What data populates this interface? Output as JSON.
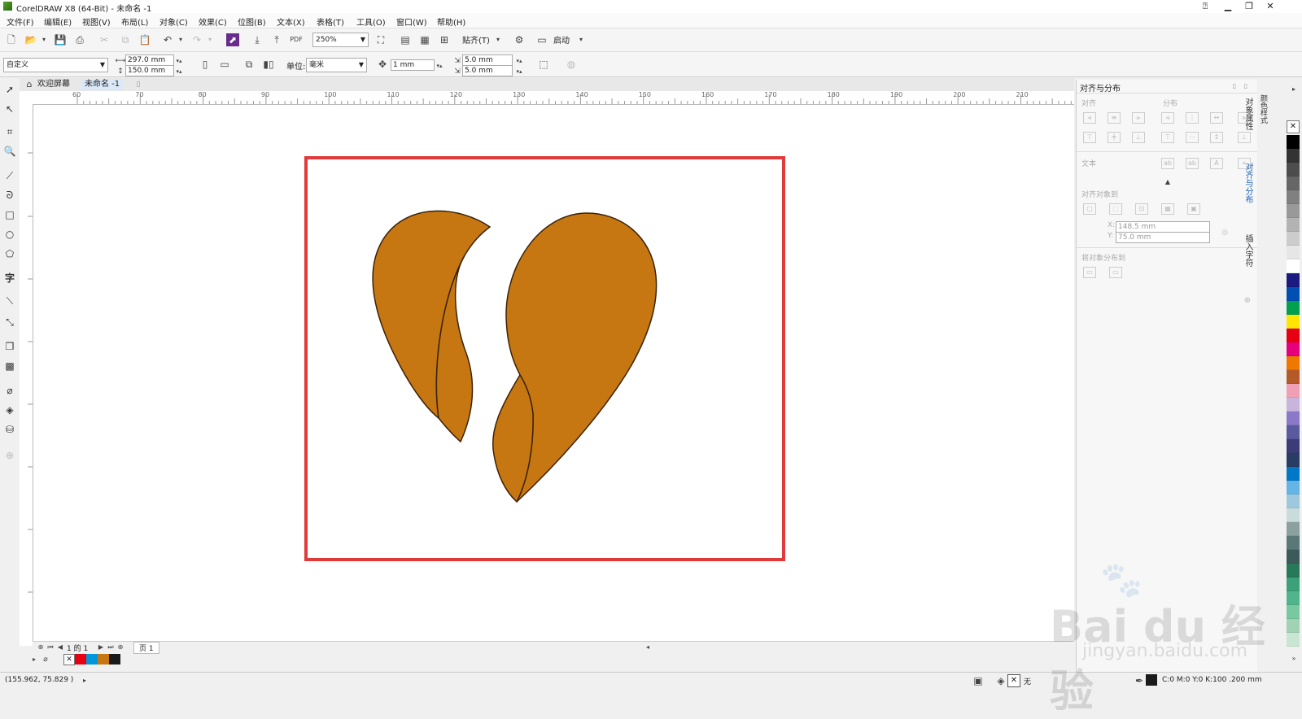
{
  "window": {
    "title": "CorelDRAW X8 (64-Bit) - 未命名 -1"
  },
  "menu": [
    "文件(F)",
    "编辑(E)",
    "视图(V)",
    "布局(L)",
    "对象(C)",
    "效果(C)",
    "位图(B)",
    "文本(X)",
    "表格(T)",
    "工具(O)",
    "窗口(W)",
    "帮助(H)"
  ],
  "toolbar": {
    "zoom": "250%",
    "snap_label": "贴齐(T)",
    "launch_label": "启动"
  },
  "property_bar": {
    "preset": "自定义",
    "width": "297.0 mm",
    "height": "150.0 mm",
    "units_label": "单位:",
    "units": "毫米",
    "nudge": "1 mm",
    "dup_x": "5.0 mm",
    "dup_y": "5.0 mm"
  },
  "tabs": [
    "欢迎屏幕",
    "未命名 -1"
  ],
  "ruler": {
    "h_ticks": [
      "60",
      "70",
      "80",
      "90",
      "100",
      "110",
      "120",
      "130",
      "140",
      "150",
      "160",
      "170",
      "180",
      "190",
      "200",
      "210"
    ]
  },
  "page_nav": {
    "counter": "1 的 1",
    "page_tab": "页 1"
  },
  "status": {
    "coords": "(155.962, 75.829 )",
    "fill_none": "无",
    "fill_info": "C:0 M:0 Y:0 K:100 .200 mm"
  },
  "docker": {
    "title": "对齐与分布",
    "align_label": "对齐",
    "distribute_label": "分布",
    "text_label": "文本",
    "align_to_label": "对齐对象到",
    "x_value": "148.5 mm",
    "y_value": "75.0 mm",
    "x_label": "X:",
    "y_label": "Y:",
    "distribute_to_label": "将对象分布到"
  },
  "docker_tabs": [
    "对象属性",
    "对齐与分布",
    "插入字符"
  ],
  "right_edge_tab": "颜色样式",
  "palette_colors": [
    "#000000",
    "#333333",
    "#4d4d4d",
    "#666666",
    "#808080",
    "#999999",
    "#b3b3b3",
    "#cccccc",
    "#e6e6e6",
    "#ffffff",
    "#1a1a80",
    "#0050b4",
    "#00a050",
    "#ffe600",
    "#e60012",
    "#e6007e",
    "#ee7800",
    "#b45a28",
    "#f0a0b4",
    "#c8b4dc",
    "#8c78c8",
    "#5a5aa0",
    "#3c3c78",
    "#283c64",
    "#0078c8",
    "#64b4e6",
    "#a0c8dc",
    "#c8dcdc",
    "#8ca0a0",
    "#5a7878",
    "#3c5a5a",
    "#28785a",
    "#3ca078",
    "#50b48c",
    "#78c8a0",
    "#a0d2b4",
    "#c8e6d2"
  ],
  "doc_palette": [
    "#e60012",
    "#0096dc",
    "#c77712",
    "#1a1a1a"
  ],
  "watermark": {
    "text": "Bai du 经验",
    "url": "jingyan.baidu.com"
  },
  "colors": {
    "highlight_rect": "#e03a3a",
    "shape_fill": "#c77712",
    "shape_stroke": "#3a2208"
  }
}
